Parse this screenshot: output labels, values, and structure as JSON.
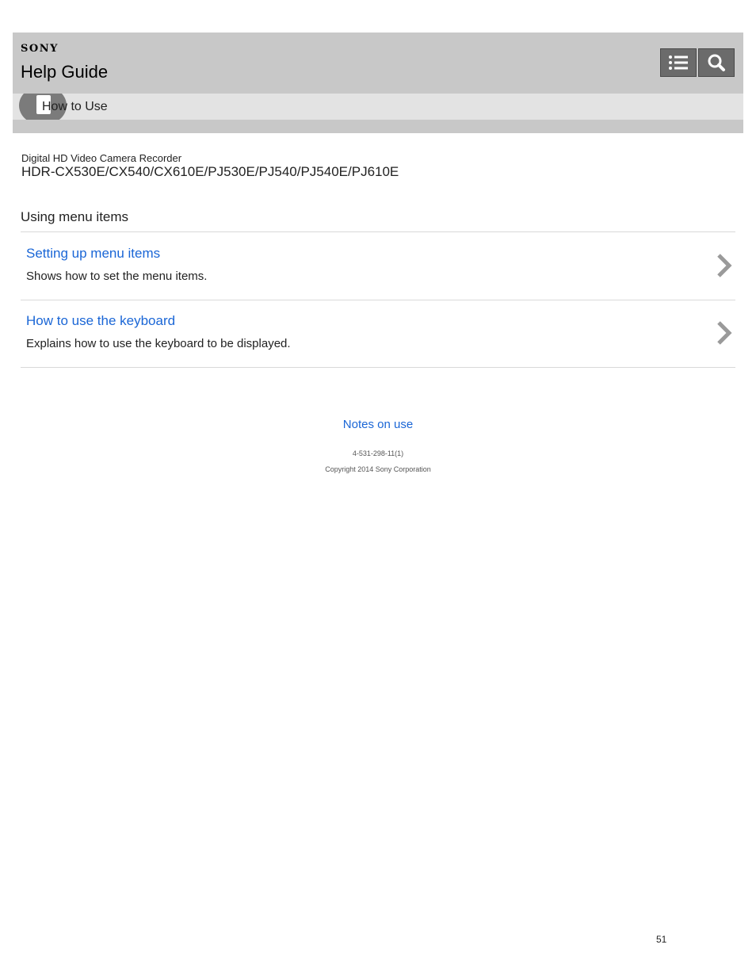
{
  "header": {
    "brand": "SONY",
    "title": "Help Guide",
    "list_button_icon": "list-icon",
    "search_button_icon": "search-icon"
  },
  "category": {
    "icon": "document-icon",
    "label": "How to Use"
  },
  "product": {
    "type": "Digital HD Video Camera Recorder",
    "models": "HDR-CX530E/CX540/CX610E/PJ530E/PJ540/PJ540E/PJ610E"
  },
  "section": {
    "title": "Using menu items",
    "items": [
      {
        "link": "Setting up menu items",
        "description": "Shows how to set the menu items."
      },
      {
        "link": "How to use the keyboard",
        "description": "Explains how to use the keyboard to be displayed."
      }
    ]
  },
  "footer": {
    "notes_link": "Notes on use",
    "doc_code": "4-531-298-11(1)",
    "copyright": "Copyright 2014 Sony Corporation"
  },
  "page_number": "51",
  "colors": {
    "link": "#1a66d6",
    "header_bg": "#c8c8c8",
    "button_bg": "#6b6b6b"
  }
}
